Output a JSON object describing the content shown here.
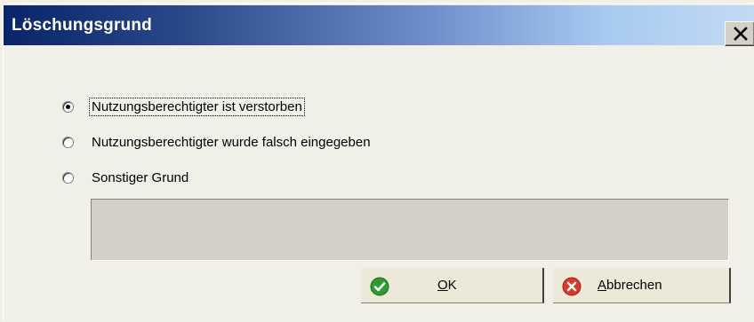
{
  "dialog": {
    "title": "Löschungsgrund",
    "close_label": "X"
  },
  "reasons": {
    "options": [
      {
        "label": "Nutzungsberechtigter ist verstorben",
        "checked": true
      },
      {
        "label": "Nutzungsberechtigter wurde falsch eingegeben",
        "checked": false
      },
      {
        "label": "Sonstiger Grund",
        "checked": false
      }
    ],
    "other_text": ""
  },
  "buttons": {
    "ok": {
      "mnemonic": "O",
      "rest": "K",
      "icon": "check-icon",
      "icon_color": "#2f9a2f"
    },
    "cancel": {
      "mnemonic": "A",
      "rest": "bbrechen",
      "icon": "cancel-x-icon",
      "icon_color": "#d83a2a"
    }
  }
}
